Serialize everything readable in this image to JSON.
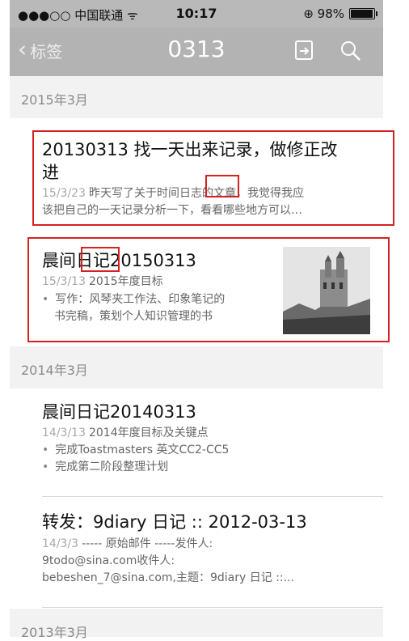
{
  "status_bar": {
    "carrier": "●●●○○ 中国联通 ᯤ",
    "time": "10:17",
    "battery_text": "⊕ 98%",
    "battery_level": 0.98
  },
  "nav": {
    "back_label": "标签",
    "title": "0313",
    "share_icon": "share-icon",
    "search_icon": "search-icon"
  },
  "sections": [
    {
      "label": "2015年3月"
    },
    {
      "label": "2014年3月"
    },
    {
      "label": "2013年3月"
    }
  ],
  "notes": [
    {
      "title_line1": "20130313  找一天出来记录，做修正改",
      "title_line2": "进",
      "date": "15/3/23",
      "meta_line1": "昨天写了关于时间日志的文章，我觉得我应",
      "meta_line2": "该把自己的一天记录分析一下，看看哪些地方可以…"
    },
    {
      "title": "晨间日记20150313",
      "date": "15/3/13",
      "meta": "2015年度目标",
      "bullets": [
        "写作：风琴夹工作法、印象笔记的",
        "书完稿，策划个人知识管理的书"
      ]
    },
    {
      "title": "晨间日记20140313",
      "date": "14/3/13",
      "meta": "2014年度目标及关键点",
      "bullets": [
        "完成Toastmasters 英文CC2-CC5",
        "完成第二阶段整理计划"
      ]
    },
    {
      "title": "转发：9diary 日记 :: 2012-03-13",
      "date": "14/3/3",
      "meta_line1": "----- 原始邮件 -----发件人:",
      "meta_line2": "9todo@sina.com收件人:",
      "meta_line3": "bebeshen_7@sina.com,主题：9diary 日记 ::..."
    }
  ],
  "colors": {
    "highlight_box": "#d42222",
    "nav_bg": "#b3b3b3"
  }
}
